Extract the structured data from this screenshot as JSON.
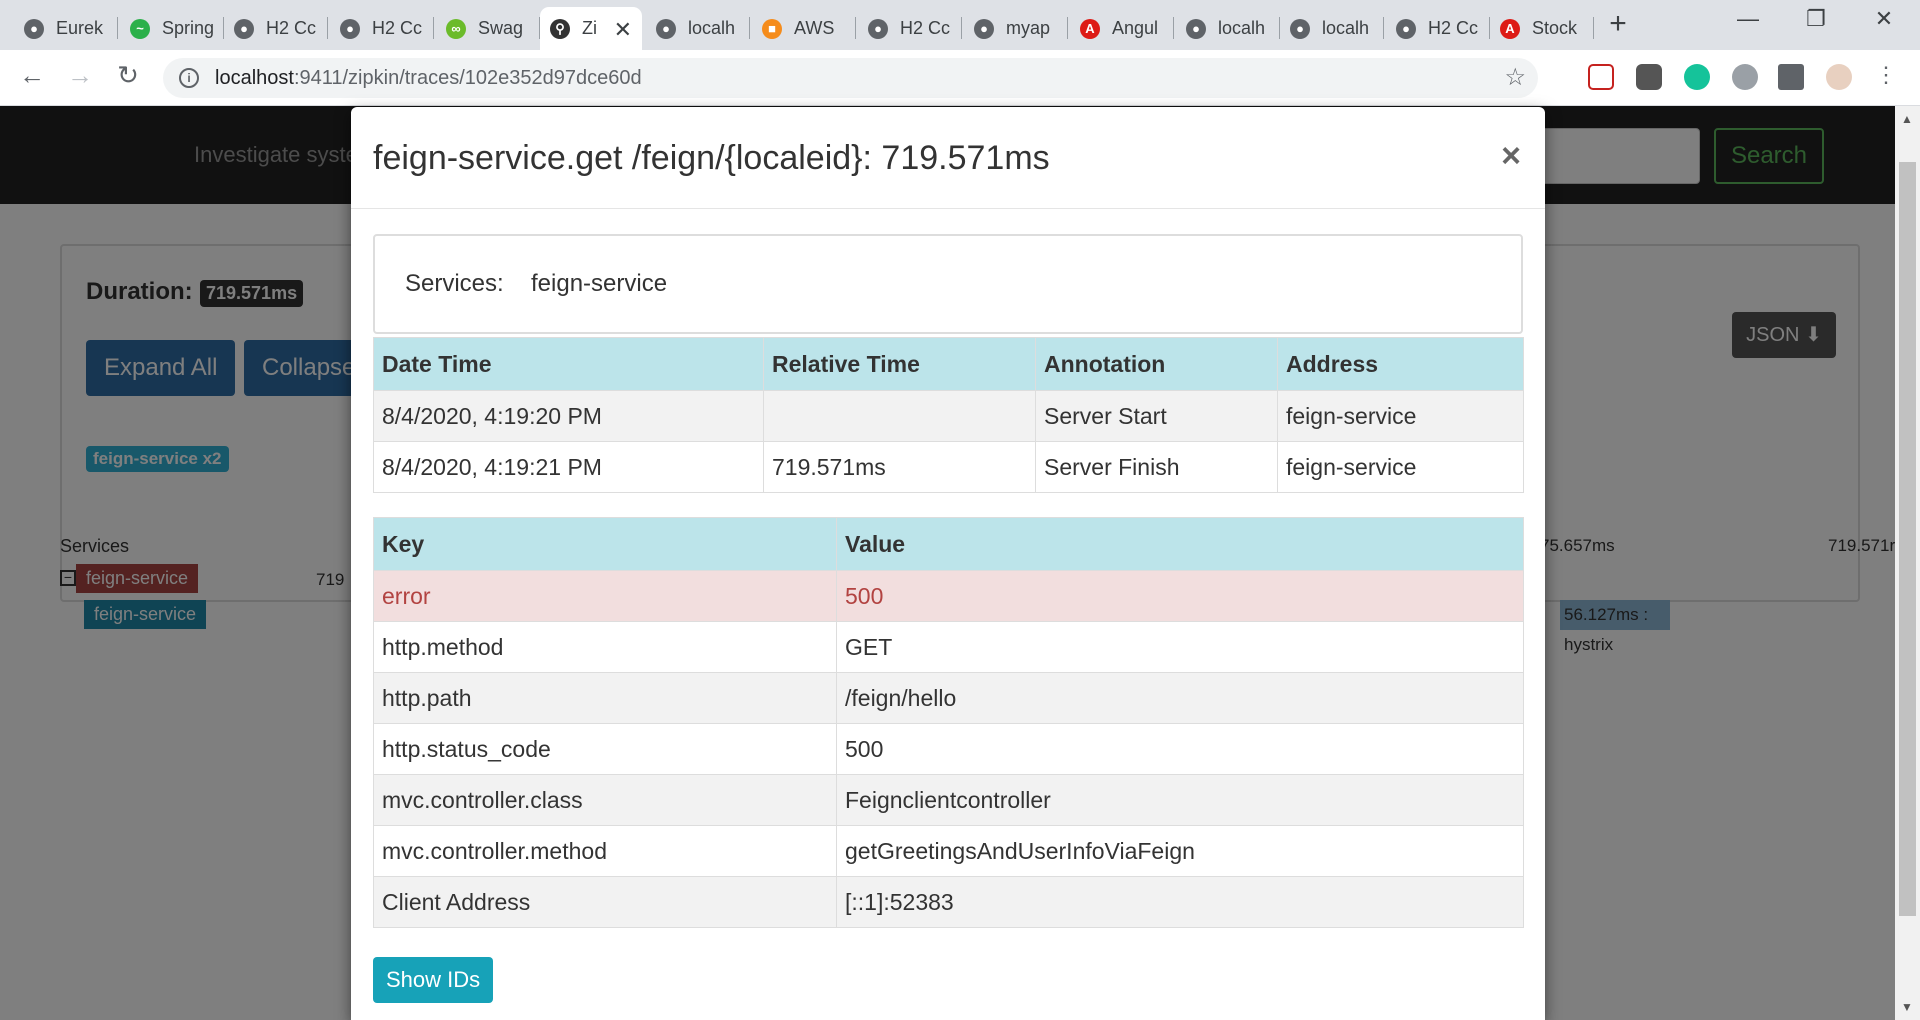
{
  "browser": {
    "tabs": [
      {
        "label": "Eurek",
        "icon": "globe-icon",
        "color": "#5f6368"
      },
      {
        "label": "Spring",
        "icon": "pulse-icon",
        "color": "#2bb04a"
      },
      {
        "label": "H2 Cc",
        "icon": "globe-icon",
        "color": "#5f6368"
      },
      {
        "label": "H2 Cc",
        "icon": "globe-icon",
        "color": "#5f6368"
      },
      {
        "label": "Swag",
        "icon": "swagger-icon",
        "color": "#6bbb2a"
      },
      {
        "label": "Zi",
        "icon": "zipkin-icon",
        "color": "#333333"
      },
      {
        "label": "localh",
        "icon": "globe-icon",
        "color": "#5f6368"
      },
      {
        "label": "AWS",
        "icon": "aws-icon",
        "color": "#f58c1b"
      },
      {
        "label": "H2 Cc",
        "icon": "globe-icon",
        "color": "#5f6368"
      },
      {
        "label": "myap",
        "icon": "globe-icon",
        "color": "#5f6368"
      },
      {
        "label": "Angul",
        "icon": "angular-icon",
        "color": "#dd1b16"
      },
      {
        "label": "localh",
        "icon": "globe-icon",
        "color": "#5f6368"
      },
      {
        "label": "localh",
        "icon": "globe-icon",
        "color": "#5f6368"
      },
      {
        "label": "H2 Cc",
        "icon": "globe-icon",
        "color": "#5f6368"
      },
      {
        "label": "Stock",
        "icon": "angular-icon",
        "color": "#dd1b16"
      }
    ],
    "active_tab": 5,
    "url_host": "localhost",
    "url_path": ":9411/zipkin/traces/102e352d97dce60d"
  },
  "zipkin": {
    "nav_hint": "Investigate syster",
    "search_label": "Search",
    "duration_label": "Duration:",
    "duration_value": "719.571ms",
    "expand_label": "Expand All",
    "collapse_label": "Collapse",
    "service_badge": "feign-service x2",
    "json_label": "JSON",
    "services_header": "Services",
    "service_rows": [
      "feign-service",
      "feign-service"
    ],
    "time_prefix": "719",
    "time_mid": "75.657ms",
    "time_end": "719.571r",
    "span_label": "56.127ms : hystrix"
  },
  "modal": {
    "title": "feign-service.get /feign/{localeid}: 719.571ms",
    "close": "×",
    "services_label": "Services:",
    "services_value": "feign-service",
    "annotation_headers": [
      "Date Time",
      "Relative Time",
      "Annotation",
      "Address"
    ],
    "annotations": [
      [
        "8/4/2020, 4:19:20 PM",
        "",
        "Server Start",
        "feign-service"
      ],
      [
        "8/4/2020, 4:19:21 PM",
        "719.571ms",
        "Server Finish",
        "feign-service"
      ]
    ],
    "tag_headers": [
      "Key",
      "Value"
    ],
    "tags": [
      [
        "error",
        "500"
      ],
      [
        "http.method",
        "GET"
      ],
      [
        "http.path",
        "/feign/hello"
      ],
      [
        "http.status_code",
        "500"
      ],
      [
        "mvc.controller.class",
        "Feignclientcontroller"
      ],
      [
        "mvc.controller.method",
        "getGreetingsAndUserInfoViaFeign"
      ],
      [
        "Client Address",
        "[::1]:52383"
      ]
    ],
    "show_ids_label": "Show IDs"
  }
}
